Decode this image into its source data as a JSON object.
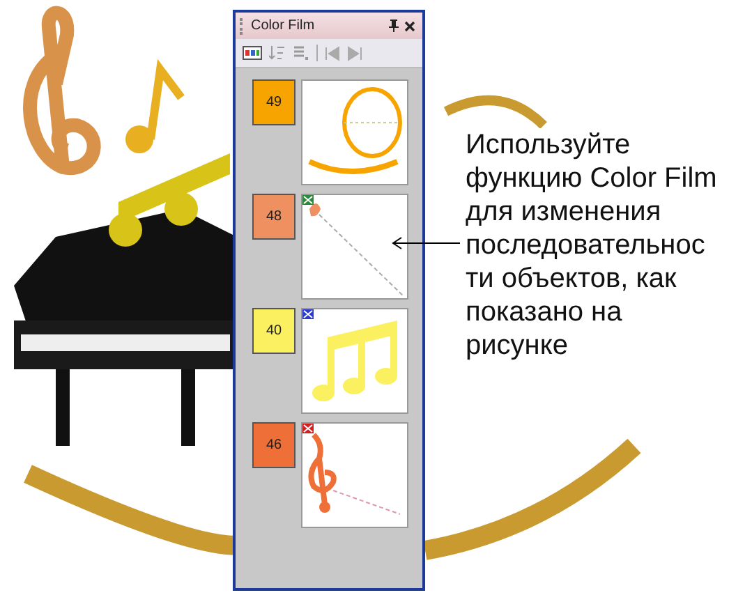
{
  "panel": {
    "title": "Color Film"
  },
  "items": [
    {
      "number": "49",
      "color": "#f7a400",
      "kind": "circle"
    },
    {
      "number": "48",
      "color": "#ef9060",
      "kind": "stroke",
      "flag": {
        "color": "#2a8a3a"
      }
    },
    {
      "number": "40",
      "color": "#fbf160",
      "kind": "notes",
      "flag": {
        "color": "#2b3bd0"
      }
    },
    {
      "number": "46",
      "color": "#ee7038",
      "kind": "clef",
      "flag": {
        "color": "#d02020"
      }
    }
  ],
  "callout": "Используйте функцию Color Film для изменения последовательнос ти объектов, как показано на рисунке"
}
